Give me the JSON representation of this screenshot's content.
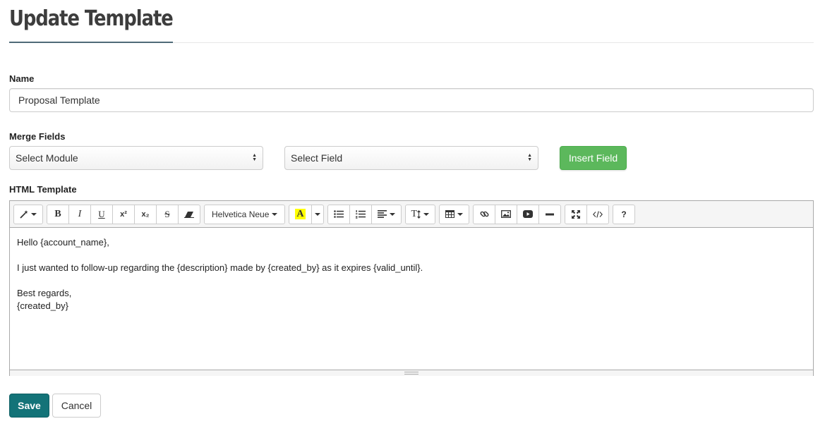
{
  "page": {
    "title": "Update Template"
  },
  "form": {
    "name_label": "Name",
    "name_value": "Proposal Template",
    "merge_label": "Merge Fields",
    "module_select": "Select Module",
    "field_select": "Select Field",
    "insert_button": "Insert Field",
    "html_label": "HTML Template"
  },
  "toolbar": {
    "bold": "B",
    "italic": "I",
    "underline": "U",
    "superscript": "x²",
    "subscript": "x₂",
    "strike": "S",
    "font_name": "Helvetica Neue",
    "color_letter": "A",
    "height_label": "T",
    "help": "?"
  },
  "editor": {
    "lines": [
      "Hello {account_name},",
      "",
      "I just wanted to follow-up regarding the {description} made by {created_by} as it expires {valid_until}.",
      "",
      "Best regards,",
      "{created_by}"
    ]
  },
  "actions": {
    "save": "Save",
    "cancel": "Cancel"
  },
  "colors": {
    "accent": "#137378",
    "success": "#5cb85c",
    "highlight": "#ffff00"
  }
}
